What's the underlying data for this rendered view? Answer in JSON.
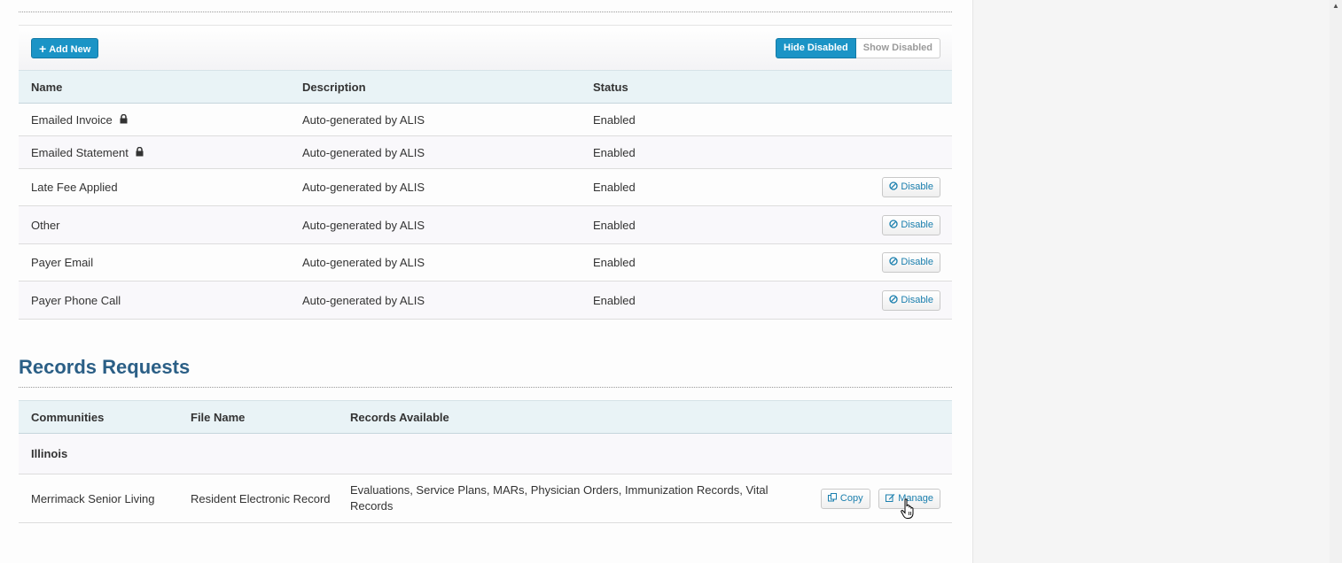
{
  "types_section": {
    "toolbar": {
      "add_new_label": "Add New",
      "hide_disabled_label": "Hide Disabled",
      "show_disabled_label": "Show Disabled"
    },
    "columns": [
      "Name",
      "Description",
      "Status"
    ],
    "rows": [
      {
        "name": "Emailed Invoice",
        "description": "Auto-generated by ALIS",
        "status": "Enabled",
        "locked": true,
        "action": ""
      },
      {
        "name": "Emailed Statement",
        "description": "Auto-generated by ALIS",
        "status": "Enabled",
        "locked": true,
        "action": ""
      },
      {
        "name": "Late Fee Applied",
        "description": "Auto-generated by ALIS",
        "status": "Enabled",
        "locked": false,
        "action": "Disable"
      },
      {
        "name": "Other",
        "description": "Auto-generated by ALIS",
        "status": "Enabled",
        "locked": false,
        "action": "Disable"
      },
      {
        "name": "Payer Email",
        "description": "Auto-generated by ALIS",
        "status": "Enabled",
        "locked": false,
        "action": "Disable"
      },
      {
        "name": "Payer Phone Call",
        "description": "Auto-generated by ALIS",
        "status": "Enabled",
        "locked": false,
        "action": "Disable"
      }
    ]
  },
  "records_section": {
    "title": "Records Requests",
    "columns": [
      "Communities",
      "File Name",
      "Records Available"
    ],
    "group": "Illinois",
    "row": {
      "community": "Merrimack Senior Living",
      "file_name": "Resident Electronic Record",
      "records_available": "Evaluations, Service Plans, MARs, Physician Orders, Immunization Records, Vital Records",
      "copy_label": "Copy",
      "manage_label": "Manage"
    }
  },
  "icons": [
    "plus-icon",
    "lock-icon",
    "ban-icon",
    "copy-icon",
    "edit-icon",
    "hand-cursor-icon",
    "scroll-up-arrow-icon"
  ],
  "colors": {
    "primary": "#1b94c6",
    "heading": "#2b5f86",
    "table_header_bg": "#e9f3f6",
    "link": "#1a7fae"
  }
}
